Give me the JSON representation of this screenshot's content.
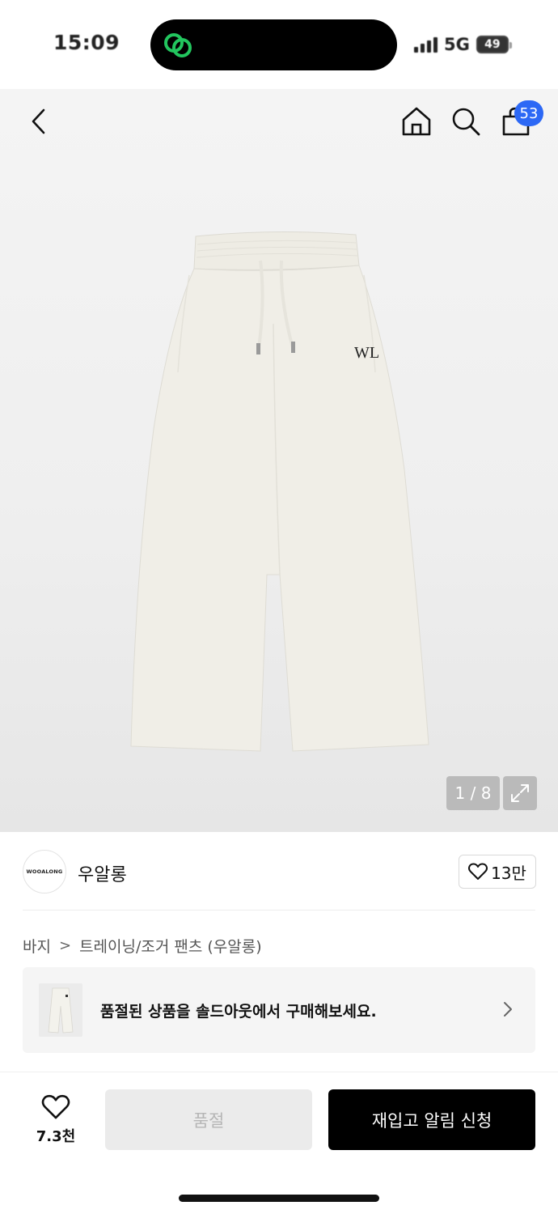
{
  "status_bar": {
    "time": "15:09",
    "network": "5G",
    "battery": "49"
  },
  "header": {
    "cart_count": "53"
  },
  "gallery": {
    "counter": "1 / 8"
  },
  "brand": {
    "logo_text": "WOOALONG",
    "name": "우알롱",
    "likes": "13만"
  },
  "breadcrumb": {
    "category": "바지",
    "separator": ">",
    "subcategory": "트레이닝/조거 팬츠 (우알롱)"
  },
  "soldout_banner": {
    "text": "품절된 상품을 솔드아웃에서 구매해보세요."
  },
  "bottom_bar": {
    "wish_count": "7.3천",
    "soldout_label": "품절",
    "restock_label": "재입고 알림 신청"
  },
  "icons": {
    "back": "chevron-left-icon",
    "home": "home-icon",
    "search": "search-icon",
    "cart": "shopping-bag-icon",
    "expand": "expand-icon",
    "heart": "heart-icon",
    "chevron": "chevron-right-icon"
  },
  "colors": {
    "badge": "#2c68f5",
    "primary_button": "#000000",
    "disabled_button": "#ebebeb",
    "island_icon": "#22c55e"
  }
}
